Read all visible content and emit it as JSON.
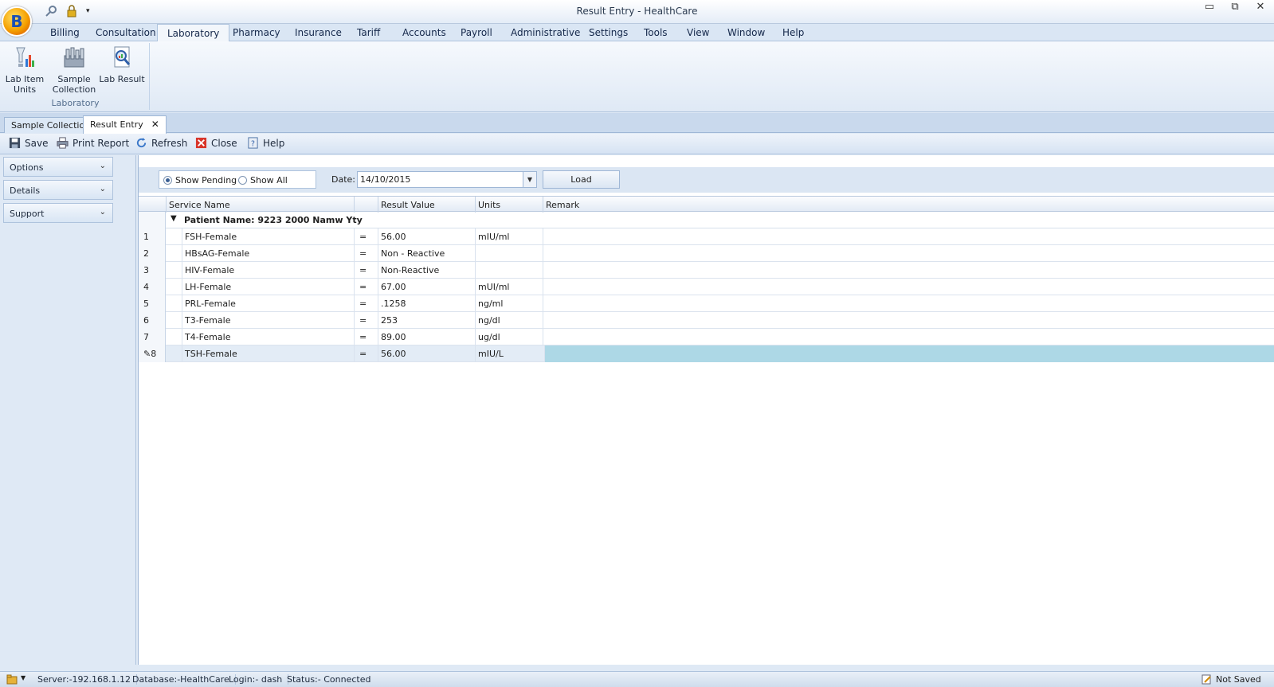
{
  "window": {
    "title": "Result Entry - HealthCare",
    "app_letter": "B",
    "controls": [
      "▭",
      "⧉",
      "✕"
    ]
  },
  "ribbon": {
    "tabs": [
      "Billing",
      "Consultation",
      "Laboratory",
      "Pharmacy",
      "Insurance",
      "Tariff",
      "Accounts",
      "Payroll",
      "Administrative",
      "Settings",
      "Tools",
      "View",
      "Window",
      "Help"
    ],
    "active_tab": "Laboratory",
    "group_label": "Laboratory",
    "buttons": [
      {
        "label_line1": "Lab Item",
        "label_line2": "Units",
        "icon": "lab-item-units-icon"
      },
      {
        "label_line1": "Sample",
        "label_line2": "Collection",
        "icon": "sample-collection-icon"
      },
      {
        "label_line1": "Lab Result",
        "label_line2": "",
        "icon": "lab-result-icon"
      }
    ]
  },
  "doc_tabs": [
    {
      "label": "Sample Collection",
      "active": false
    },
    {
      "label": "Result Entry",
      "active": true,
      "close": "✕"
    }
  ],
  "toolbar": {
    "save": "Save",
    "print_report": "Print Report",
    "refresh": "Refresh",
    "close": "Close",
    "help": "Help"
  },
  "side_panel": {
    "items": [
      "Options",
      "Details",
      "Support"
    ],
    "chevron": "⌄"
  },
  "filter": {
    "show_pending": "Show Pending",
    "show_all": "Show All",
    "selected": "Show Pending",
    "date_label": "Date:",
    "date_value": "14/10/2015",
    "load_label": "Load"
  },
  "grid": {
    "headers": [
      "Service Name",
      "",
      "Result Value",
      "Units",
      "Remark"
    ],
    "group_title": "Patient Name: 9223  2000  Namw Yty",
    "rows": [
      {
        "num": "1",
        "service": "FSH-Female",
        "op": "=",
        "result": "56.00",
        "units": "mIU/ml",
        "remark": ""
      },
      {
        "num": "2",
        "service": "HBsAG-Female",
        "op": "=",
        "result": "Non - Reactive",
        "units": "",
        "remark": ""
      },
      {
        "num": "3",
        "service": "HIV-Female",
        "op": "=",
        "result": "Non-Reactive",
        "units": "",
        "remark": ""
      },
      {
        "num": "4",
        "service": "LH-Female",
        "op": "=",
        "result": "67.00",
        "units": "mUI/ml",
        "remark": ""
      },
      {
        "num": "5",
        "service": "PRL-Female",
        "op": "=",
        "result": ".1258",
        "units": "ng/ml",
        "remark": ""
      },
      {
        "num": "6",
        "service": "T3-Female",
        "op": "=",
        "result": "253",
        "units": "ng/dl",
        "remark": ""
      },
      {
        "num": "7",
        "service": "T4-Female",
        "op": "=",
        "result": "89.00",
        "units": "ug/dl",
        "remark": ""
      },
      {
        "num": "8",
        "service": "TSH-Female",
        "op": "=",
        "result": "56.00",
        "units": "mIU/L",
        "remark": "",
        "selected": true,
        "edit_marker": "✎"
      }
    ]
  },
  "statusbar": {
    "server": "Server:-192.168.1.12",
    "database": "Database:-HealthCare",
    "login": "Login:- dash",
    "status": "Status:- Connected",
    "save_state": "Not Saved"
  },
  "colors": {
    "accent": "#1a4fb5",
    "selected_cell": "#add8e6",
    "panel": "#dfe9f5"
  }
}
